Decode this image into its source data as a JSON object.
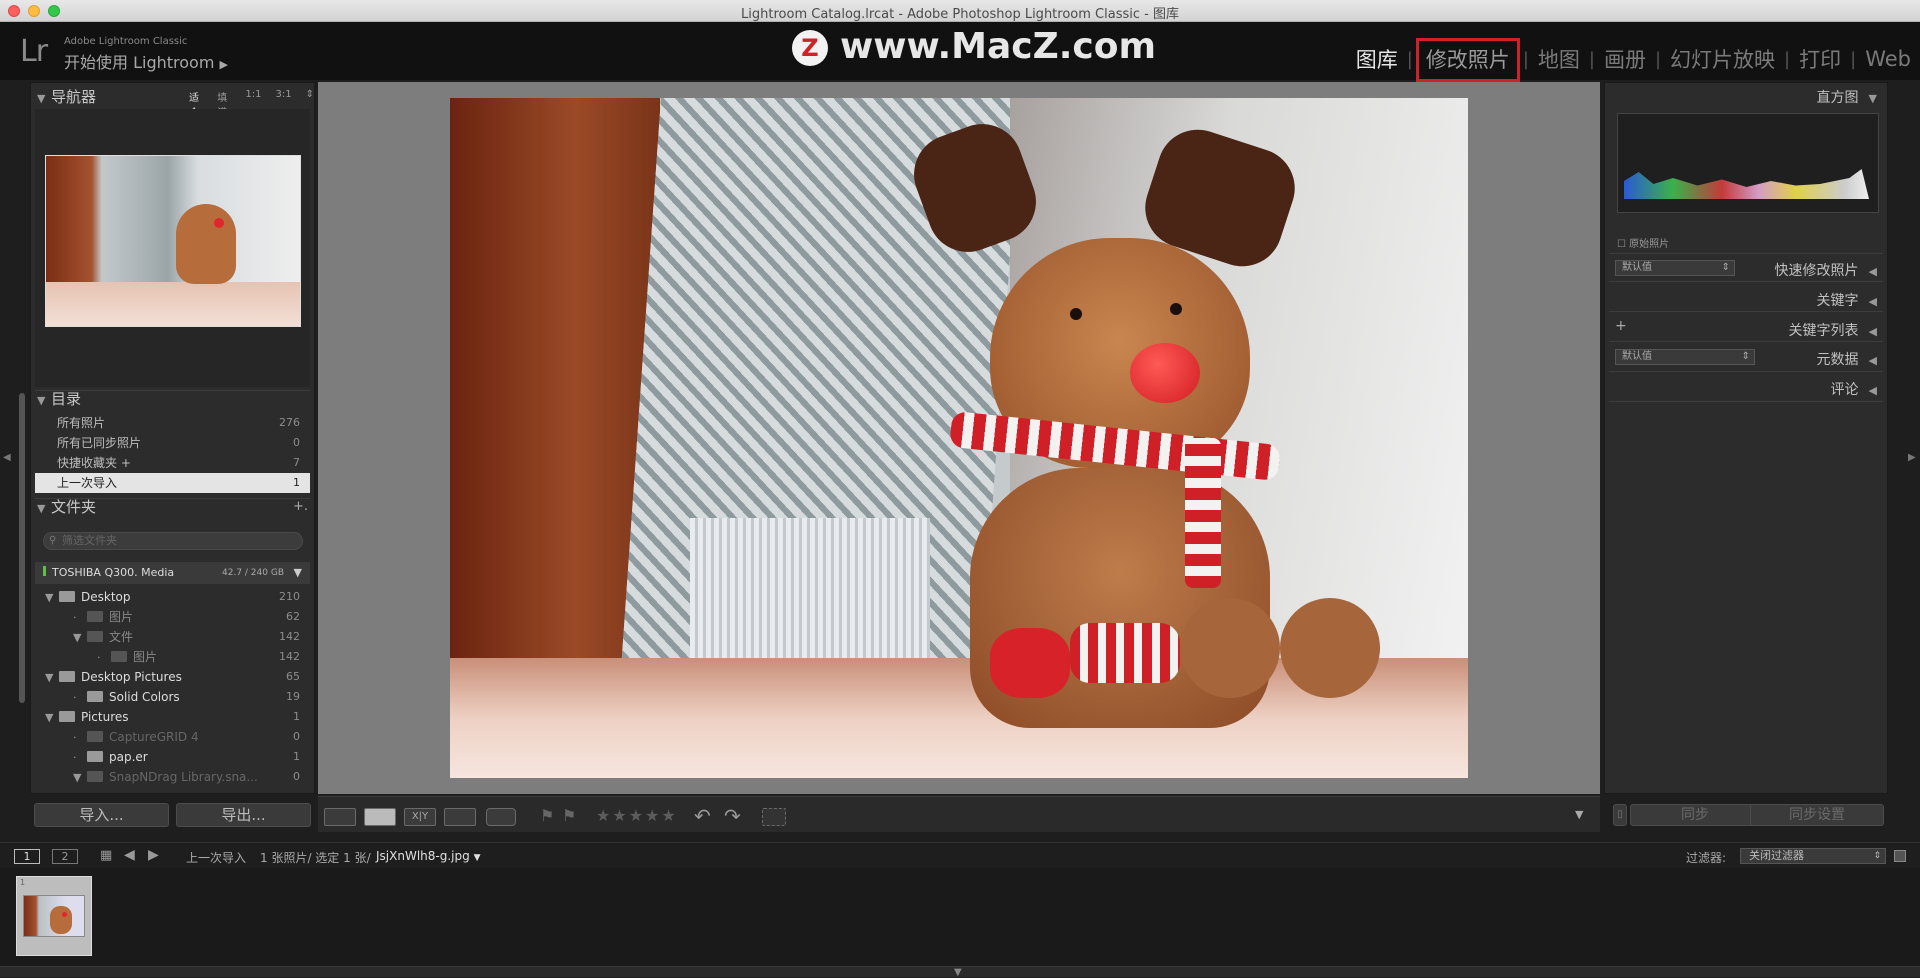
{
  "window": {
    "title": "Lightroom Catalog.lrcat - Adobe Photoshop Lightroom Classic - 图库"
  },
  "identity": {
    "logo": "Lr",
    "app_small": "Adobe Lightroom Classic",
    "app_big": "开始使用 Lightroom",
    "arrow": "▶"
  },
  "watermark": {
    "badge": "Z",
    "text": "www.MacZ.com"
  },
  "modules": [
    {
      "label": "图库"
    },
    {
      "label": "修改照片"
    },
    {
      "label": "地图"
    },
    {
      "label": "画册"
    },
    {
      "label": "幻灯片放映"
    },
    {
      "label": "打印"
    },
    {
      "label": "Web"
    }
  ],
  "navigator": {
    "title": "导航器",
    "zoom_options": [
      "适合",
      "填满",
      "1:1",
      "3:1"
    ]
  },
  "catalog": {
    "title": "目录",
    "items": [
      {
        "label": "所有照片",
        "count": "276"
      },
      {
        "label": "所有已同步照片",
        "count": "0"
      },
      {
        "label": "快捷收藏夹 +",
        "count": "7"
      },
      {
        "label": "上一次导入",
        "count": "1"
      }
    ]
  },
  "folders": {
    "title": "文件夹",
    "add": "+.",
    "search_placeholder": "筛选文件夹",
    "volume": {
      "name": "TOSHIBA Q300. Media",
      "size": "42.7 / 240 GB"
    },
    "items": [
      {
        "label": "Desktop",
        "count": "210"
      },
      {
        "label": "图片",
        "count": "62"
      },
      {
        "label": "文件",
        "count": "142"
      },
      {
        "label": "图片",
        "count": "142"
      },
      {
        "label": "Desktop Pictures",
        "count": "65"
      },
      {
        "label": "Solid Colors",
        "count": "19"
      },
      {
        "label": "Pictures",
        "count": "1"
      },
      {
        "label": "CaptureGRID 4",
        "count": "0"
      },
      {
        "label": "pap.er",
        "count": "1"
      },
      {
        "label": "SnapNDrag Library.sna...",
        "count": "0"
      }
    ]
  },
  "left_buttons": {
    "import": "导入...",
    "export": "导出..."
  },
  "right_panels": {
    "histogram": "直方图",
    "original_photo": "原始照片",
    "quick_develop": "快速修改照片",
    "keywording": "关键字",
    "keyword_list": "关键字列表",
    "metadata": "元数据",
    "comments": "评论",
    "preset_default": "默认值",
    "plus": "+"
  },
  "right_buttons": {
    "sync": "同步",
    "sync_settings": "同步设置"
  },
  "toolbar": {
    "stars": "★★★★★",
    "xy": "X|Y"
  },
  "filmstrip_bar": {
    "page1": "1",
    "page2": "2",
    "source": "上一次导入",
    "info": "1 张照片/ 选定 1 张/",
    "filename": "JsjXnWlh8-g.jpg",
    "filter_label": "过滤器:",
    "filter_value": "关闭过滤器"
  },
  "filmstrip": {
    "thumb_index": "1"
  },
  "colors": {
    "accent_red": "#d0202a",
    "panel": "#2c2c2c",
    "bg": "#1e1e1e"
  }
}
